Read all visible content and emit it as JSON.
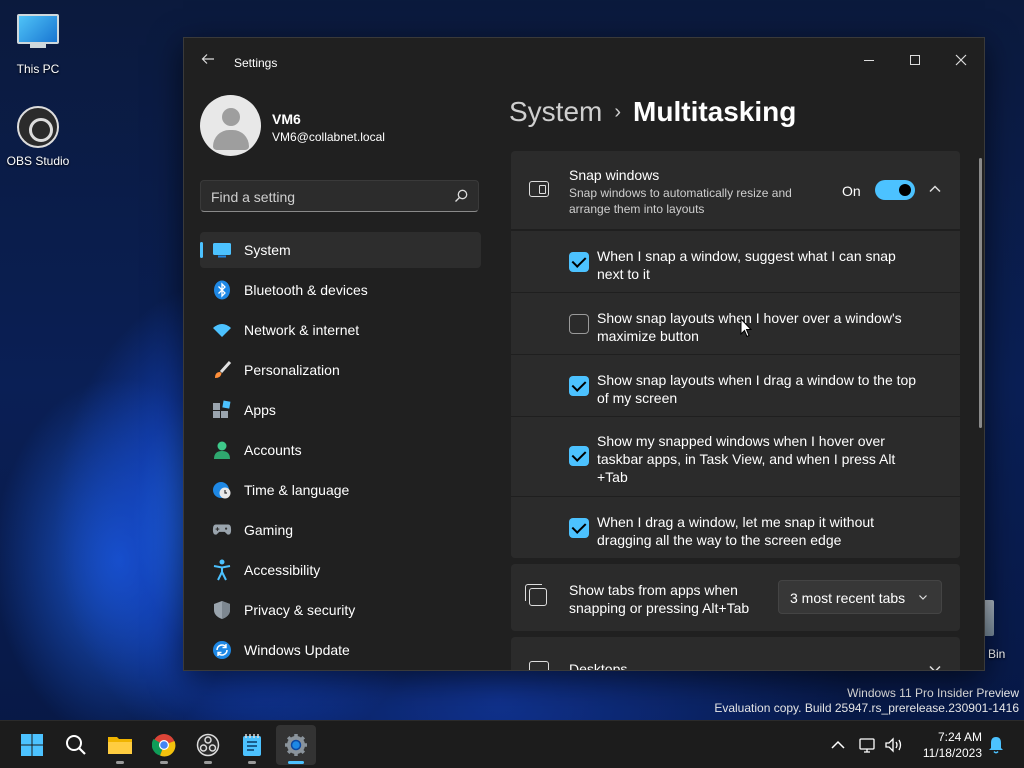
{
  "desktop": {
    "icons": [
      {
        "label": "This PC"
      },
      {
        "label": "OBS Studio"
      }
    ],
    "recycle_bin_label": "Bin",
    "watermark": {
      "line1": "Windows 11 Pro Insider Preview",
      "line2": "Evaluation copy. Build 25947.rs_prerelease.230901-1416"
    }
  },
  "window": {
    "title": "Settings",
    "profile": {
      "name": "VM6",
      "email": "VM6@collabnet.local"
    },
    "search": {
      "placeholder": "Find a setting"
    },
    "nav": [
      {
        "label": "System",
        "icon": "system-icon",
        "active": true
      },
      {
        "label": "Bluetooth & devices",
        "icon": "bluetooth-icon"
      },
      {
        "label": "Network & internet",
        "icon": "network-icon"
      },
      {
        "label": "Personalization",
        "icon": "brush-icon"
      },
      {
        "label": "Apps",
        "icon": "apps-icon"
      },
      {
        "label": "Accounts",
        "icon": "accounts-icon"
      },
      {
        "label": "Time & language",
        "icon": "globe-clock-icon"
      },
      {
        "label": "Gaming",
        "icon": "gamepad-icon"
      },
      {
        "label": "Accessibility",
        "icon": "accessibility-icon"
      },
      {
        "label": "Privacy & security",
        "icon": "shield-icon"
      },
      {
        "label": "Windows Update",
        "icon": "update-icon"
      }
    ],
    "breadcrumb": {
      "parent": "System",
      "separator": "›",
      "current": "Multitasking"
    },
    "snap": {
      "title": "Snap windows",
      "description": "Snap windows to automatically resize and arrange them into layouts",
      "toggle_label": "On",
      "toggle_on": true,
      "options": [
        {
          "label": "When I snap a window, suggest what I can snap next to it",
          "checked": true
        },
        {
          "label": "Show snap layouts when I hover over a window's maximize button",
          "checked": false
        },
        {
          "label": "Show snap layouts when I drag a window to the top of my screen",
          "checked": true
        },
        {
          "label": "Show my snapped windows when I hover over taskbar apps, in Task View, and when I press Alt +Tab",
          "checked": true
        },
        {
          "label": "When I drag a window, let me snap it without dragging all the way to the screen edge",
          "checked": true
        }
      ]
    },
    "tabs": {
      "title": "Show tabs from apps when snapping or pressing Alt+Tab",
      "selected": "3 most recent tabs"
    },
    "desktops": {
      "title": "Desktops"
    }
  },
  "taskbar": {
    "apps": [
      "start-icon",
      "search-icon",
      "file-explorer-icon",
      "chrome-icon",
      "obs-icon",
      "notepad-icon",
      "settings-icon"
    ],
    "time": "7:24 AM",
    "date": "11/18/2023"
  },
  "colors": {
    "accent": "#4cc2ff",
    "window_bg": "#202020",
    "card_bg": "#2b2b2b"
  }
}
